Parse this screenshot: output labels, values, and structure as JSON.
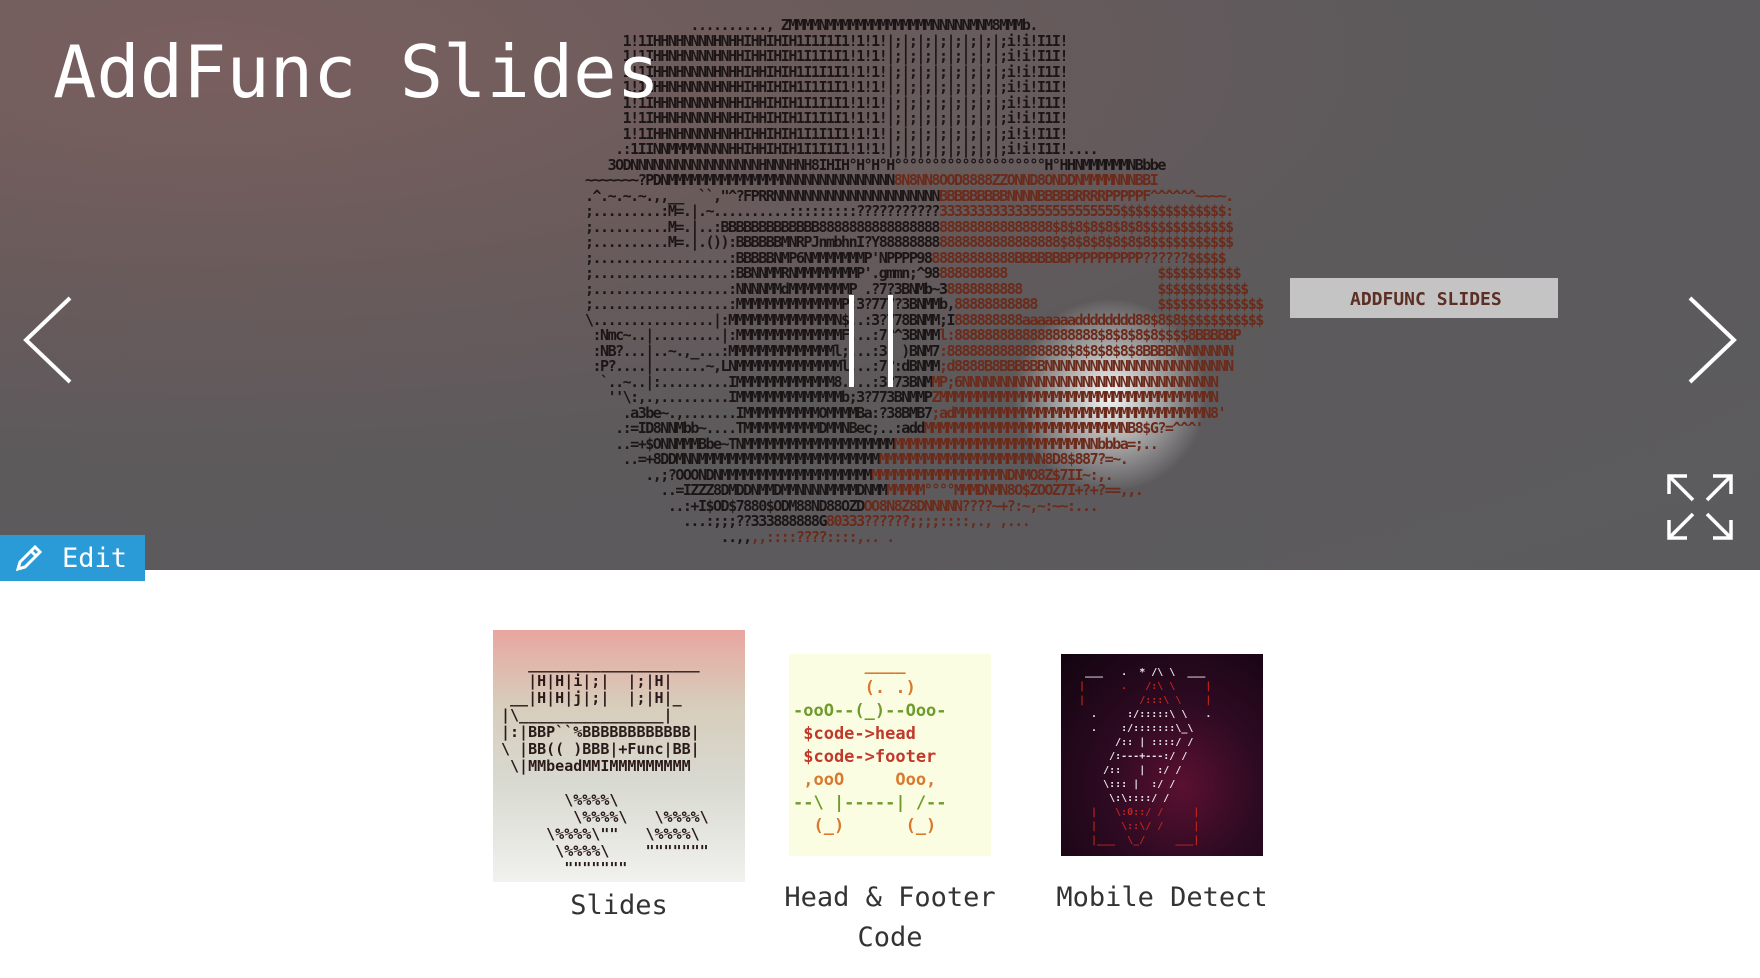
{
  "page": {
    "title": "AddFunc Slides"
  },
  "hero": {
    "current_slide_caption": "ADDFUNC SLIDES",
    "prev_icon": "chevron-left-icon",
    "next_icon": "chevron-right-icon",
    "pause_icon": "pause-icon",
    "fullscreen_icon": "expand-icon",
    "ascii_art": [
      "              .........., ZMMMMNMMMMMMMMMMMMMMNNNNNMNM8MMMb.",
      "     1!1IHHNHNNNNHNHHIHHIHIH1I1I1I1!1!1!|;|;|;|;|;|;|;|;i!i!I1I!",
      "     1!1IHHNHNNNNHNHHIHHIHIH1I1I1I1!1!1!|;|;|;|;|;|;|;|;i!i!I1I!",
      "     1!1IHHNHNNNNHNHHIHHIHIH1I1I1I1!1!1!|;|;|;|;|;|;|;|;i!i!I1I!",
      "     1!1IHHNHNNNNHNHHIHHIHIH1I1I1I1!1!1!|;|;|;|;|;|;|;|;i!i!I1I!",
      "     1!1IHHNHNNNNHNHHIHHIHIH1I1I1I1!1!1!|;|;|;|;|;|;|;|;i!i!I1I!",
      "     1!1IHHNHNNNNHNHHIHHIHIH1I1I1I1!1!1!|;|;|;|;|;|;|;|;i!i!I1I!",
      "     1!1IHHNHNNNNHNHHIHHIHIH1I1I1I1!1!1!|;|;|;|;|;|;|;|;i!i!I1I!",
      "    .:1IINNMMMMNNNNHHIHHIHIH1I1I1I1!1!1!|;|;|;|;|;|;|;|;i!i!I1I!....",
      "   3ODNNNNNNNNNNNNNNNNNHNNNHNH8IHIH°H°H°H°°°°°°°°°°°°°°°°°°°°H°HHNMMMMMMNBbbe",
      "~~~~~~~?PDNMMMMMMMMMMMMMMMNNNNNNNNNNNNNNN8N8NN8OOD8888ZZONND8ONDDNMMMMNNNBBI",
      ".^.~.~.~.,,__  ``,\"^?FPRRNNNNNNNNNNNNNNNNNNNNNNBBBBBBBBBNNNNBBBBBRRRRPPPPPF^^^^^^~~~~.",
      ";.........:M=.|.~..........:::::::::???????????333333333333555555555555$$$$$$$$$$$$$$:",
      ";..........M=.|..:BBBBBBBBBBBBB8888888888888888888888888888888$8$8$8$8$8$8$$$$$$$$$$$$",
      ";..........M=.|.()):BBBBBBMNRPJnmbhnI?Y888888888888888888888888$8$8$8$8$8$8$$$$$$$$$$$",
      ";..................:BBBBBNMP6NMMMMMMMP'NPPPP9888888888888BBBBBBBPPPPPPPPPP??????$$$$$",
      ";..................:BBNNMMRNMMMMMMMMP'.gmmn;^98888888888                    $$$$$$$$$$$",
      ";..................:NNNNMMdMMMMMMMMP .?7?3BNMb~38888888888                  $$$$$$$$$$$$",
      ";..................:MMMMMMMMMMMMMMP;3?777?3BNMMb,88888888888                $$$$$$$$$$$$$$",
      "\\................|:MMMMMMMMMMMMMMN$..:3?778BNMM;I888888888aaaaaaadddddddd88$8$8$$$$$$$$$$$",
      " :Nmc~..|.........|:MMMMMMMMMMMMMMF...:7?^3BNMMl:8888888888888888888$8$8$8$8$$$$8BBBBBP",
      " :NB?...|..~.,_...:MMMMMMMMMMMMMMl;...:3( )BNM7:8888888888888888$8$8$8$8$8BBBBNNNNNNNN",
      " :P?....|.......~,LNMMMMMMMMMMMMMMl...:7?:dBNMM;d8888B8BBBBBBNNNNNNNNNNNNNNNNNNNNNNNNN",
      "  `..~..|:.........IMMMMMMMMMMMMM8....:3?73BNMMP;6NNNNNNNNNNNNNNNNNNNNNNNNNNNNNNNNNN",
      "   ''\\:,.,.........IMMMMMMMMMMMMMMb;3?773BNMMPZMMMMMMMMMMMMMMMMMMMMMMMMMMMMMMMMMMMMN",
      "     .a3be~.,.......IMMMMMMMMMMOMMMMBa:?38BMB7;adMMMMMMMMMMMMMMMMMMMMMMMMMMMMMMMMMN8'",
      "    .:=ID8NNMbb~....TMMMMMMMMMMDMMNBec;..:addMMMMMMMMMMMMMMMMMMMMMMMMMMNB8$G?=^^^'",
      "    ..=+$ONNMMMBbe~TNMMMMMMMMMMMMMMMMMMMMMMMMMMMMMMMMMMMMMMMMMMMMMNNbbba=;..",
      "     ..=+8DDMNNMMMMMMMMMMMMMMMMMMMMMMMMMMMMMMMMMMMMMMMMMMMMNN8D8$887?=~.",
      "        .,;?OOONDNMMMMMMMMMMMMMMMMMMMMMMMMMMMMMMMMMMMMMNDNMO8Z$7II~:,.",
      "          ..=IZZZ8DMDDNMMDMMNNNNMMMMDNMMMMMMM°°°°MMMDNMN8O$ZOOZ7I+?+?==,,.",
      "           ..:+I$OD$7880$ODM88ND88OZDOO8N8Z8DNNNNN????~+?:~,~:~~:...",
      "             ...:;;;??333888888G80333??????;;;;::::,., ,...",
      "                  ..,,,,::::????::::,.. ."
    ]
  },
  "edit": {
    "label": "Edit",
    "icon": "pencil-icon"
  },
  "gallery": {
    "items": [
      {
        "label": "Slides",
        "thumb_ascii": [
          "   ___________________",
          "   |H|H|i|;|  |;|H|",
          " __|H|H|j|;|  |;|H|_",
          "|\\________________|",
          "|:|BBP``%BBBBBBBBBBBB|",
          "\\ |BB(( )BBB|+Func|BB|",
          " \\|MMbeadMMIMMMMMMMMM",
          "",
          "       \\%%%%\\",
          "        \\%%%%\\   \\%%%%\\",
          "     \\%%%%\\\"\"   \\%%%%\\",
          "      \\%%%%\\    \"\"\"\"\"\"\"",
          "       \"\"\"\"\"\"\""
        ]
      },
      {
        "label": "Head & Footer Code",
        "thumb_ascii": [
          "       ____",
          "       (. .)",
          "-ooO--(_)--Ooo-",
          " $code->head",
          " $code->footer",
          " ,ooO     Ooo,",
          "--\\ |-----| /--",
          "  (_)      (_)"
        ]
      },
      {
        "label": "Mobile Detect",
        "thumb_ascii": [
          " ___   .  * /\\ \\  ___",
          "|      .   /:\\ \\     |",
          "|         /:::\\ \\    |",
          "  .     :/:::::\\ \\   .",
          "  .    :/:::::::\\_\\",
          "      /:: | ::::/ /",
          "     /:---+---:/ /",
          "    /::   |  :/ /",
          "    \\::: |  :/ /",
          "     \\:\\::::/ /",
          "  |   \\:0::/ /     |",
          "  |    \\::\\/ /     |",
          "  |___  \\_/     ___|"
        ]
      }
    ]
  },
  "colors": {
    "edit_bg": "#2a9bd6",
    "ascii_dark": "#1b1516",
    "ascii_rust": "#6b2a1a",
    "slides_thumb_dark": "#2a1a1a",
    "head_thumb_orange": "#d9792d",
    "head_thumb_red": "#c0392b",
    "head_thumb_green": "#6f9b2d",
    "mobile_thumb_red": "#c0241c",
    "mobile_thumb_white": "#e8e8e8"
  }
}
